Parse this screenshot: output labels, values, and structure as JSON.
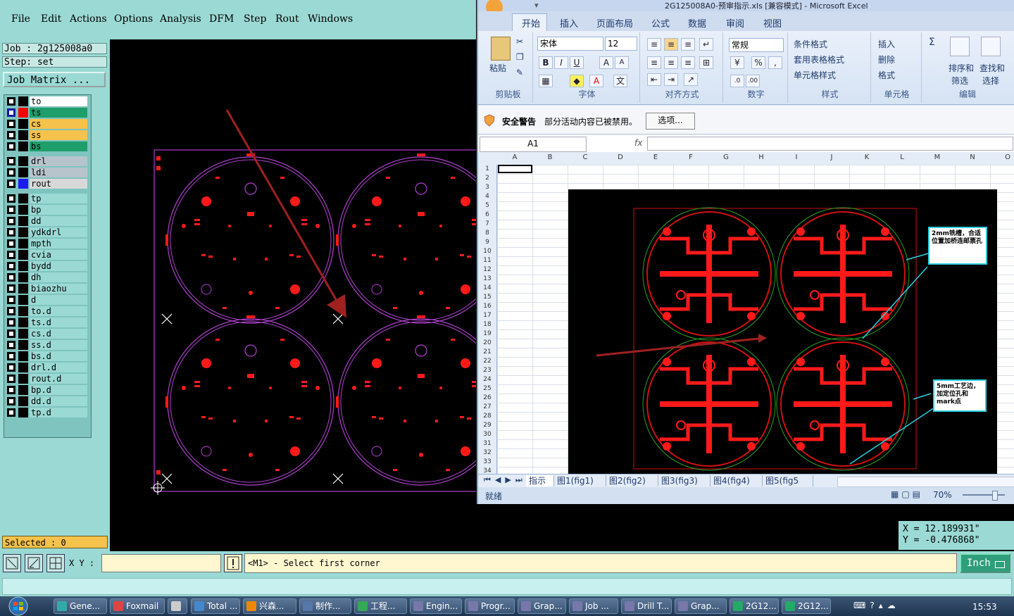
{
  "cam": {
    "menu": [
      "File",
      "Edit",
      "Actions",
      "Options",
      "Analysis",
      "DFM",
      "Step",
      "Rout",
      "Windows"
    ],
    "job_label": "Job : 2g125008a0",
    "step_label": "Step: set",
    "job_matrix_button": "Job Matrix ...",
    "layers": [
      {
        "name": "to",
        "color": "#ffffff",
        "selected": false,
        "swatch": "#000000"
      },
      {
        "name": "ts",
        "color": "#1e9e6a",
        "selected": true,
        "swatch": "#ff0000"
      },
      {
        "name": "cs",
        "color": "#f5c24b",
        "selected": false,
        "swatch": "#000000"
      },
      {
        "name": "ss",
        "color": "#f5c24b",
        "selected": false,
        "swatch": "#000000"
      },
      {
        "name": "bs",
        "color": "#1e9e6a",
        "selected": false,
        "swatch": "#000000"
      },
      {
        "name": "drl",
        "color": "#b8c4cc",
        "selected": false,
        "swatch": "#000000"
      },
      {
        "name": "ldi",
        "color": "#b8c4cc",
        "selected": false,
        "swatch": "#000000"
      },
      {
        "name": "rout",
        "color": "#d8d8d8",
        "selected": false,
        "swatch": "#1a1aff"
      },
      {
        "name": "tp",
        "color": "#9bd9d4",
        "selected": false,
        "swatch": "#000000"
      },
      {
        "name": "bp",
        "color": "#9bd9d4",
        "selected": false,
        "swatch": "#000000"
      },
      {
        "name": "dd",
        "color": "#9bd9d4",
        "selected": false,
        "swatch": "#000000"
      },
      {
        "name": "ydkdrl",
        "color": "#9bd9d4",
        "selected": false,
        "swatch": "#000000"
      },
      {
        "name": "mpth",
        "color": "#9bd9d4",
        "selected": false,
        "swatch": "#000000"
      },
      {
        "name": "cvia",
        "color": "#9bd9d4",
        "selected": false,
        "swatch": "#000000"
      },
      {
        "name": "bydd",
        "color": "#9bd9d4",
        "selected": false,
        "swatch": "#000000"
      },
      {
        "name": "dh",
        "color": "#9bd9d4",
        "selected": false,
        "swatch": "#000000"
      },
      {
        "name": "biaozhu",
        "color": "#9bd9d4",
        "selected": false,
        "swatch": "#000000"
      },
      {
        "name": "d",
        "color": "#9bd9d4",
        "selected": false,
        "swatch": "#000000"
      },
      {
        "name": "to.d",
        "color": "#9bd9d4",
        "selected": false,
        "swatch": "#000000"
      },
      {
        "name": "ts.d",
        "color": "#9bd9d4",
        "selected": false,
        "swatch": "#000000"
      },
      {
        "name": "cs.d",
        "color": "#9bd9d4",
        "selected": false,
        "swatch": "#000000"
      },
      {
        "name": "ss.d",
        "color": "#9bd9d4",
        "selected": false,
        "swatch": "#000000"
      },
      {
        "name": "bs.d",
        "color": "#9bd9d4",
        "selected": false,
        "swatch": "#000000"
      },
      {
        "name": "drl.d",
        "color": "#9bd9d4",
        "selected": false,
        "swatch": "#000000"
      },
      {
        "name": "rout.d",
        "color": "#9bd9d4",
        "selected": false,
        "swatch": "#000000"
      },
      {
        "name": "bp.d",
        "color": "#9bd9d4",
        "selected": false,
        "swatch": "#000000"
      },
      {
        "name": "dd.d",
        "color": "#9bd9d4",
        "selected": false,
        "swatch": "#000000"
      },
      {
        "name": "tp.d",
        "color": "#9bd9d4",
        "selected": false,
        "swatch": "#000000"
      }
    ],
    "selected_label": "Selected : 0",
    "xy_label": "X Y :",
    "xy_value": "",
    "message": "<M1> - Select first corner",
    "units": "Inch",
    "coord_x": "X =  12.189931\"",
    "coord_y": "Y = -0.476868\""
  },
  "excel": {
    "title": "2G125008A0-预审指示.xls [兼容模式] - Microsoft Excel",
    "tabs": [
      "开始",
      "插入",
      "页面布局",
      "公式",
      "数据",
      "审阅",
      "视图"
    ],
    "ribbon": {
      "paste": "粘贴",
      "clipboard": "剪贴板",
      "font_name": "宋体",
      "font_size": "12",
      "font_group": "字体",
      "align_group": "对齐方式",
      "number_format": "常规",
      "number_group": "数字",
      "cond_format": "条件格式",
      "table_format": "套用表格格式",
      "cell_style": "单元格样式",
      "style_group": "样式",
      "insert": "插入",
      "delete": "删除",
      "format": "格式",
      "cells_group": "单元格",
      "sort_filter_1": "排序和",
      "sort_filter_2": "筛选",
      "find_select_1": "查找和",
      "find_select_2": "选择",
      "edit_group": "编辑"
    },
    "security_title": "安全警告",
    "security_msg": "部分活动内容已被禁用。",
    "security_btn": "选项...",
    "name_box": "A1",
    "fx": "fx",
    "columns": [
      "A",
      "B",
      "C",
      "D",
      "E",
      "F",
      "G",
      "H",
      "I",
      "J",
      "K",
      "L",
      "M",
      "N",
      "O"
    ],
    "rows": [
      "1",
      "2",
      "3",
      "4",
      "5",
      "6",
      "7",
      "8",
      "9",
      "10",
      "11",
      "12",
      "13",
      "14",
      "15",
      "16",
      "17",
      "18",
      "19",
      "20",
      "21",
      "22",
      "23",
      "24",
      "25",
      "26",
      "27",
      "28",
      "29",
      "30",
      "31",
      "32",
      "33",
      "34"
    ],
    "note1": "2mm铣槽，合适位置加桥连邮票孔",
    "note2": "5mm工艺边，加定位孔和mark点",
    "sheets": [
      "指示",
      "图1(fig1)",
      "图2(fig2)",
      "图3(fig3)",
      "图4(fig4)",
      "图5(fig5"
    ],
    "status": "就绪",
    "zoom": "70%"
  },
  "taskbar": {
    "items": [
      "Gene...",
      "Foxmail",
      "",
      "Total ...",
      "兴森...",
      "制作...",
      "工程...",
      "Engin...",
      "Progr...",
      "Grap...",
      "Job ...",
      "Drill T...",
      "Grap...",
      "2G12...",
      "2G12..."
    ],
    "clock": "15:53"
  }
}
